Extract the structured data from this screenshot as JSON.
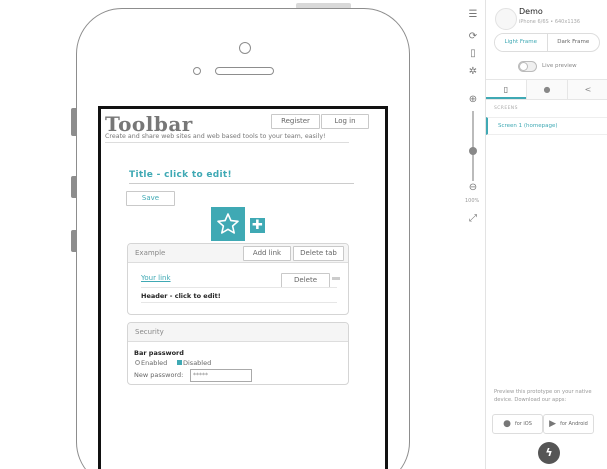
{
  "app": {
    "logo": "Toolbar",
    "tagline": "Create and share web sites and web based tools to your team, easily!",
    "register_label": "Register",
    "login_label": "Log in"
  },
  "page": {
    "title": "Title - click to edit!",
    "save_label": "Save"
  },
  "example_panel": {
    "heading": "Example",
    "add_link_label": "Add link",
    "delete_tab_label": "Delete tab",
    "link_text": "Your link",
    "delete_label": "Delete",
    "header_text": "Header - click to edit!"
  },
  "security_panel": {
    "heading": "Security",
    "bar_password_label": "Bar password",
    "enabled_label": "Enabled",
    "disabled_label": "Disabled",
    "new_password_label": "New password:",
    "new_password_value": "*****"
  },
  "zoom": {
    "label": "100%"
  },
  "sidebar": {
    "project_name": "Demo",
    "device_info": "iPhone 6/6S • 640x1136",
    "light_frame_label": "Light Frame",
    "dark_frame_label": "Dark Frame",
    "live_preview_label": "Live preview",
    "screens_heading": "SCREENS",
    "screens": [
      {
        "label": "Screen 1 (homepage)"
      }
    ],
    "preview_note": "Preview this prototype on your native device. Download our apps:",
    "ios_label": "for iOS",
    "android_label": "for Android"
  },
  "colors": {
    "accent": "#3fa9b4"
  }
}
